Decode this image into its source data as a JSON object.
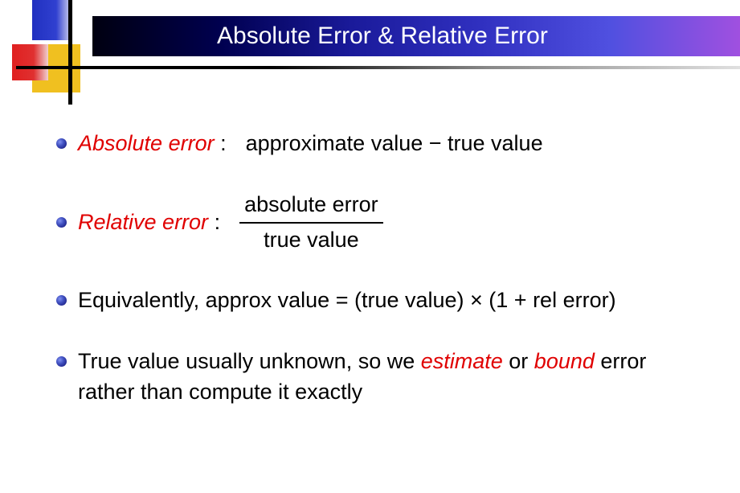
{
  "title": "Absolute Error & Relative Error",
  "bullets": {
    "b1": {
      "term": "Absolute error",
      "colon": " :",
      "def": "approximate value − true value"
    },
    "b2": {
      "term": "Relative error",
      "colon": " :",
      "frac_top": "absolute error",
      "frac_bot": "true value"
    },
    "b3": {
      "text": "Equivalently, approx value = (true value) × (1 + rel error)"
    },
    "b4": {
      "pre": "True value usually unknown, so we ",
      "em1": "estimate",
      "mid": " or ",
      "em2": "bound",
      "post": " error rather than compute it exactly"
    }
  }
}
